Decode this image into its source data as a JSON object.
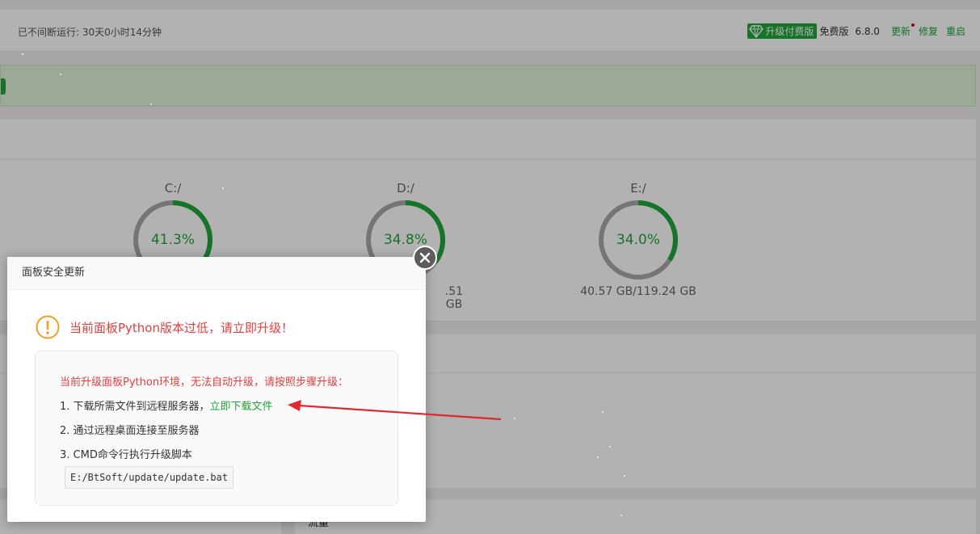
{
  "topbar": {
    "uptime": "已不间断运行: 30天0小时14分钟",
    "upgrade_label": "升级付费版",
    "edition": "免费版",
    "version": "6.8.0",
    "update_label": "更新",
    "repair_label": "修复",
    "restart_label": "重启"
  },
  "disks": [
    {
      "label": "C:/",
      "percent": "41.3%",
      "fraction": 0.413,
      "size": ""
    },
    {
      "label": "D:/",
      "percent": "34.8%",
      "fraction": 0.348,
      "size": ".51 GB"
    },
    {
      "label": "E:/",
      "percent": "34.0%",
      "fraction": 0.34,
      "size": "40.57 GB/119.24 GB"
    }
  ],
  "bottom": {
    "right_title": "流量"
  },
  "dialog": {
    "title": "面板安全更新",
    "warning": "当前面板Python版本过低，请立即升级！",
    "intro": "当前升级面板Python环境，无法自动升级，请按照步骤升级：",
    "step1": "1. 下载所需文件到远程服务器，",
    "download_link": "立即下载文件",
    "step2": "2. 通过远程桌面连接至服务器",
    "step3": "3. CMD命令行执行升级脚本",
    "command": "E:/BtSoft/update/update.bat"
  },
  "colors": {
    "accent": "#20a53a",
    "warning": "#e13f3f",
    "gauge_track": "#a8a8a8",
    "arrow": "#e0282e"
  }
}
